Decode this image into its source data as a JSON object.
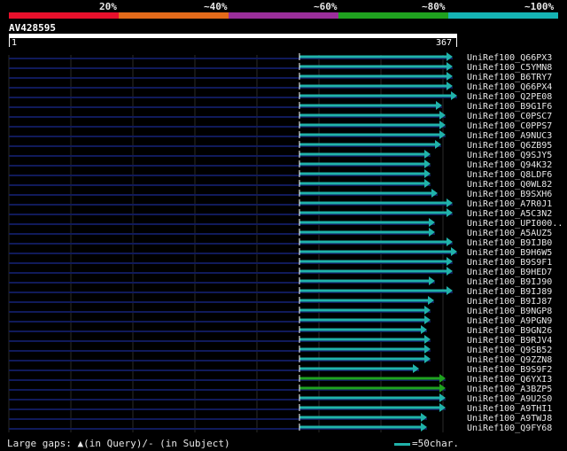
{
  "legend": {
    "segments": [
      {
        "color": "#e8102c",
        "label": "20%"
      },
      {
        "color": "#e36a1a",
        "label": "~40%"
      },
      {
        "color": "#9a2e9a",
        "label": "~60%"
      },
      {
        "color": "#1fa21f",
        "label": "~80%"
      },
      {
        "color": "#15b3b3",
        "label": "~100%"
      }
    ]
  },
  "query": {
    "id": "AV428595",
    "start": "1",
    "end": "367"
  },
  "hits": [
    {
      "label": "UniRef100_Q66PX3",
      "color": "#20b2aa",
      "end": 511
    },
    {
      "label": "UniRef100_C5YMN8",
      "color": "#20b2aa",
      "end": 511
    },
    {
      "label": "UniRef100_B6TRY7",
      "color": "#20b2aa",
      "end": 511
    },
    {
      "label": "UniRef100_Q66PX4",
      "color": "#20b2aa",
      "end": 511
    },
    {
      "label": "UniRef100_Q2PE08",
      "color": "#20b2aa",
      "end": 516
    },
    {
      "label": "UniRef100_B9G1F6",
      "color": "#20b2aa",
      "end": 499
    },
    {
      "label": "UniRef100_C0PSC7",
      "color": "#20b2aa",
      "end": 503
    },
    {
      "label": "UniRef100_C0PPS7",
      "color": "#20b2aa",
      "end": 503
    },
    {
      "label": "UniRef100_A9NUC3",
      "color": "#20b2aa",
      "end": 503
    },
    {
      "label": "UniRef100_Q6ZB95",
      "color": "#20b2aa",
      "end": 498
    },
    {
      "label": "UniRef100_Q9SJY5",
      "color": "#20b2aa",
      "end": 486
    },
    {
      "label": "UniRef100_Q94K32",
      "color": "#20b2aa",
      "end": 486
    },
    {
      "label": "UniRef100_Q8LDF6",
      "color": "#20b2aa",
      "end": 486
    },
    {
      "label": "UniRef100_Q0WL82",
      "color": "#20b2aa",
      "end": 486
    },
    {
      "label": "UniRef100_B9SXH6",
      "color": "#20b2aa",
      "end": 494
    },
    {
      "label": "UniRef100_A7R0J1",
      "color": "#20b2aa",
      "end": 511
    },
    {
      "label": "UniRef100_A5C3N2",
      "color": "#20b2aa",
      "end": 511
    },
    {
      "label": "UniRef100_UPI000..",
      "color": "#20b2aa",
      "end": 491
    },
    {
      "label": "UniRef100_A5AUZ5",
      "color": "#20b2aa",
      "end": 491
    },
    {
      "label": "UniRef100_B9IJB0",
      "color": "#20b2aa",
      "end": 511
    },
    {
      "label": "UniRef100_B9H6W5",
      "color": "#20b2aa",
      "end": 516
    },
    {
      "label": "UniRef100_B9S9F1",
      "color": "#20b2aa",
      "end": 511
    },
    {
      "label": "UniRef100_B9HED7",
      "color": "#20b2aa",
      "end": 511
    },
    {
      "label": "UniRef100_B9IJ90",
      "color": "#20b2aa",
      "end": 491
    },
    {
      "label": "UniRef100_B9IJ89",
      "color": "#20b2aa",
      "end": 511
    },
    {
      "label": "UniRef100_B9IJ87",
      "color": "#20b2aa",
      "end": 490
    },
    {
      "label": "UniRef100_B9NGP8",
      "color": "#20b2aa",
      "end": 486
    },
    {
      "label": "UniRef100_A9PGN9",
      "color": "#20b2aa",
      "end": 486
    },
    {
      "label": "UniRef100_B9GN26",
      "color": "#20b2aa",
      "end": 482
    },
    {
      "label": "UniRef100_B9RJV4",
      "color": "#20b2aa",
      "end": 486
    },
    {
      "label": "UniRef100_Q9SB52",
      "color": "#20b2aa",
      "end": 486
    },
    {
      "label": "UniRef100_Q9ZZN8",
      "color": "#20b2aa",
      "end": 486
    },
    {
      "label": "UniRef100_B9S9F2",
      "color": "#20b2aa",
      "end": 473
    },
    {
      "label": "UniRef100_Q6YXI3",
      "color": "#1fa21f",
      "end": 503
    },
    {
      "label": "UniRef100_A3BZP5",
      "color": "#1fa21f",
      "end": 503
    },
    {
      "label": "UniRef100_A9U2S0",
      "color": "#20b2aa",
      "end": 503
    },
    {
      "label": "UniRef100_A9THI1",
      "color": "#20b2aa",
      "end": 503
    },
    {
      "label": "UniRef100_A9TWJ8",
      "color": "#20b2aa",
      "end": 482
    },
    {
      "label": "UniRef100_Q9FY68",
      "color": "#20b2aa",
      "end": 482
    }
  ],
  "footer": {
    "gaps_text": "Large gaps: ▲(in Query)/- (in Subject)",
    "scale_text": "=50char."
  }
}
